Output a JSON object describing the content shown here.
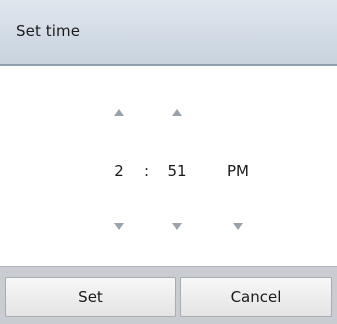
{
  "dialog": {
    "title": "Set time"
  },
  "picker": {
    "hour": "2",
    "separator": ":",
    "minute": "51",
    "ampm": "PM",
    "arrow_color": "#9aa3ab"
  },
  "buttons": {
    "set_label": "Set",
    "cancel_label": "Cancel"
  }
}
